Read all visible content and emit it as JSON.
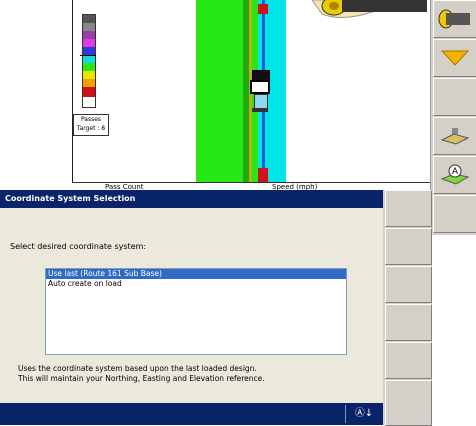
{
  "legend": {
    "passes_label": "Passes",
    "target_label": "Target : 8"
  },
  "status_bar": {
    "left_label": "Pass Count",
    "right_label": "Speed (mph)"
  },
  "colors": {
    "accent_titlebar": "#0a246a",
    "selection": "#316ac5",
    "pass_green": "#27e816",
    "pass_cyan": "#00e5e5",
    "red_mark": "#d1111a"
  },
  "right_panel": {
    "icons": [
      "roller-icon",
      "down-arrow-icon",
      "blank-button",
      "blank-button",
      "terrain-icon",
      "auto-icon"
    ]
  },
  "dialog": {
    "title": "Coordinate System Selection",
    "prompt": "Select desired coordinate system:",
    "options": [
      {
        "label": "Use last (Route 161 Sub Base)",
        "selected": true
      },
      {
        "label": "Auto create on load",
        "selected": false
      }
    ],
    "description_line1": "Uses the coordinate system based upon the last loaded design.",
    "description_line2": "This will maintain your Northing, Easting and Elevation reference.",
    "footer_icon": "Ⓐ↓"
  }
}
